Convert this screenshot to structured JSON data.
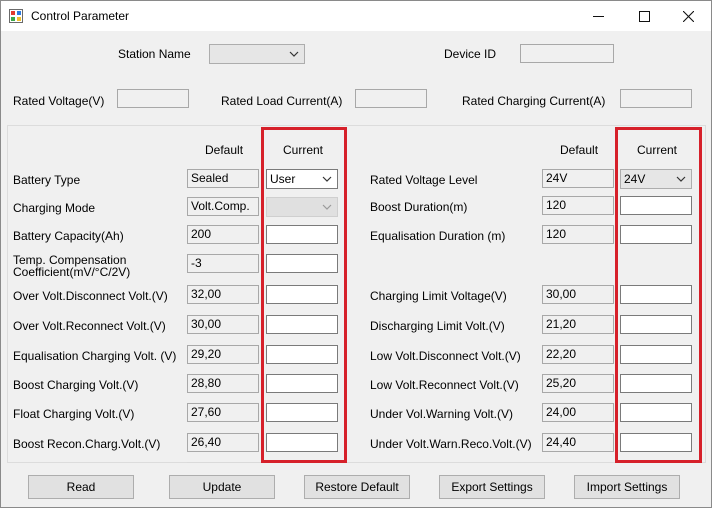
{
  "window": {
    "title": "Control Parameter"
  },
  "header": {
    "station_name_label": "Station Name",
    "station_name_value": "",
    "device_id_label": "Device ID",
    "device_id_value": "",
    "rated_voltage_label": "Rated Voltage(V)",
    "rated_voltage_value": "",
    "rated_load_current_label": "Rated Load Current(A)",
    "rated_load_current_value": "",
    "rated_charging_current_label": "Rated Charging Current(A)",
    "rated_charging_current_value": ""
  },
  "columns": {
    "default": "Default",
    "current": "Current"
  },
  "left_params": [
    {
      "label": "Battery Type",
      "default": "Sealed",
      "current": "User"
    },
    {
      "label": "Charging Mode",
      "default": "Volt.Comp.",
      "current": ""
    },
    {
      "label": "Battery Capacity(Ah)",
      "default": "200",
      "current": ""
    },
    {
      "label_line1": "Temp. Compensation",
      "label_line2": "Coefficient(mV/°C/2V)",
      "default": "-3",
      "current": ""
    },
    {
      "label": "Over Volt.Disconnect Volt.(V)",
      "default": "32,00",
      "current": ""
    },
    {
      "label": "Over Volt.Reconnect Volt.(V)",
      "default": "30,00",
      "current": ""
    },
    {
      "label": "Equalisation Charging Volt. (V)",
      "default": "29,20",
      "current": ""
    },
    {
      "label": "Boost Charging Volt.(V)",
      "default": "28,80",
      "current": ""
    },
    {
      "label": "Float Charging Volt.(V)",
      "default": "27,60",
      "current": ""
    },
    {
      "label": "Boost Recon.Charg.Volt.(V)",
      "default": "26,40",
      "current": ""
    }
  ],
  "right_params": [
    {
      "label": "Rated Voltage Level",
      "default": "24V",
      "current": "24V"
    },
    {
      "label": "Boost Duration(m)",
      "default": "120",
      "current": ""
    },
    {
      "label": "Equalisation Duration (m)",
      "default": "120",
      "current": ""
    },
    {
      "label": "Charging Limit Voltage(V)",
      "default": "30,00",
      "current": ""
    },
    {
      "label": "Discharging Limit Volt.(V)",
      "default": "21,20",
      "current": ""
    },
    {
      "label": "Low Volt.Disconnect Volt.(V)",
      "default": "22,20",
      "current": ""
    },
    {
      "label": "Low Volt.Reconnect Volt.(V)",
      "default": "25,20",
      "current": ""
    },
    {
      "label": "Under Vol.Warning Volt.(V)",
      "default": "24,00",
      "current": ""
    },
    {
      "label": "Under Volt.Warn.Reco.Volt.(V)",
      "default": "24,40",
      "current": ""
    }
  ],
  "buttons": {
    "read": "Read",
    "update": "Update",
    "restore_default": "Restore Default",
    "export_settings": "Export Settings",
    "import_settings": "Import Settings"
  },
  "colors": {
    "highlight": "#d6202a"
  }
}
